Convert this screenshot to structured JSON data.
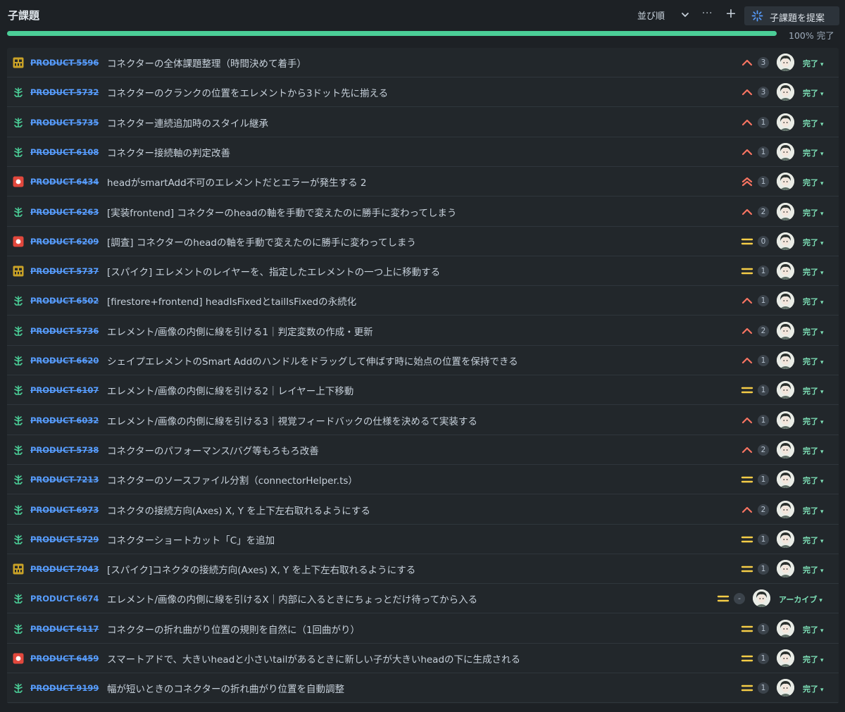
{
  "header": {
    "title": "子課題",
    "sort_label": "並び順",
    "more_label": "···",
    "add_label": "+",
    "suggest_label": "子課題を提案",
    "progress_percent": 100,
    "progress_text": "100% 完了"
  },
  "colors": {
    "background": "#1d2125",
    "list_background": "#22272b",
    "progress": "#4bce97",
    "key_link": "#579dff",
    "status_done": "#7ee2b8",
    "priority_high": "#f87462",
    "priority_medium": "#f5cd47",
    "story": "#4bce97",
    "bug": "#e2483d",
    "epic_task": "#c9a227"
  },
  "rows": [
    {
      "type": "task-icon",
      "key": "PRODUCT-5596",
      "done": true,
      "summary": "コネクターの全体課題整理（時間決めて着手）",
      "priority": "high",
      "count": "3",
      "status": "完了"
    },
    {
      "type": "story-icon",
      "key": "PRODUCT-5732",
      "done": true,
      "summary": "コネクターのクランクの位置をエレメントから3ドット先に揃える",
      "priority": "high",
      "count": "3",
      "status": "完了"
    },
    {
      "type": "story-icon",
      "key": "PRODUCT-5735",
      "done": true,
      "summary": "コネクター連続追加時のスタイル継承",
      "priority": "high",
      "count": "1",
      "status": "完了"
    },
    {
      "type": "story-icon",
      "key": "PRODUCT-6108",
      "done": true,
      "summary": "コネクター接続軸の判定改善",
      "priority": "high",
      "count": "1",
      "status": "完了"
    },
    {
      "type": "bug-icon",
      "key": "PRODUCT-6434",
      "done": true,
      "summary": "headがsmartAdd不可のエレメントだとエラーが発生する 2",
      "priority": "highest",
      "count": "1",
      "status": "完了"
    },
    {
      "type": "story-icon",
      "key": "PRODUCT-6263",
      "done": true,
      "summary": "[実装frontend] コネクターのheadの軸を手動で変えたのに勝手に変わってしまう",
      "priority": "high",
      "count": "2",
      "status": "完了"
    },
    {
      "type": "bug-icon",
      "key": "PRODUCT-6209",
      "done": true,
      "summary": "[調査] コネクターのheadの軸を手動で変えたのに勝手に変わってしまう",
      "priority": "medium",
      "count": "0",
      "status": "完了"
    },
    {
      "type": "task-icon",
      "key": "PRODUCT-5737",
      "done": true,
      "summary": "[スパイク] エレメントのレイヤーを、指定したエレメントの一つ上に移動する",
      "priority": "medium",
      "count": "1",
      "status": "完了"
    },
    {
      "type": "story-icon",
      "key": "PRODUCT-6502",
      "done": true,
      "summary": "[firestore+frontend] headIsFixedとtailIsFixedの永続化",
      "priority": "high",
      "count": "1",
      "status": "完了"
    },
    {
      "type": "story-icon",
      "key": "PRODUCT-5736",
      "done": true,
      "summary": "エレメント/画像の内側に線を引ける1｜判定変数の作成・更新",
      "priority": "high",
      "count": "2",
      "status": "完了"
    },
    {
      "type": "story-icon",
      "key": "PRODUCT-6620",
      "done": true,
      "summary": "シェイプエレメントのSmart Addのハンドルをドラッグして伸ばす時に始点の位置を保持できる",
      "priority": "high",
      "count": "1",
      "status": "完了"
    },
    {
      "type": "story-icon",
      "key": "PRODUCT-6107",
      "done": true,
      "summary": "エレメント/画像の内側に線を引ける2｜レイヤー上下移動",
      "priority": "medium",
      "count": "1",
      "status": "完了"
    },
    {
      "type": "story-icon",
      "key": "PRODUCT-6032",
      "done": true,
      "summary": "エレメント/画像の内側に線を引ける3｜視覚フィードバックの仕様を決めるて実装する",
      "priority": "high",
      "count": "1",
      "status": "完了"
    },
    {
      "type": "story-icon",
      "key": "PRODUCT-5738",
      "done": true,
      "summary": "コネクターのパフォーマンス/バグ等もろもろ改善",
      "priority": "high",
      "count": "2",
      "status": "完了"
    },
    {
      "type": "story-icon",
      "key": "PRODUCT-7213",
      "done": true,
      "summary": "コネクターのソースファイル分割（connectorHelper.ts）",
      "priority": "medium",
      "count": "1",
      "status": "完了"
    },
    {
      "type": "story-icon",
      "key": "PRODUCT-6973",
      "done": true,
      "summary": "コネクタの接続方向(Axes) X, Y を上下左右取れるようにする",
      "priority": "high",
      "count": "2",
      "status": "完了"
    },
    {
      "type": "story-icon",
      "key": "PRODUCT-5729",
      "done": true,
      "summary": "コネクターショートカット「C」を追加",
      "priority": "medium",
      "count": "1",
      "status": "完了"
    },
    {
      "type": "task-icon",
      "key": "PRODUCT-7043",
      "done": true,
      "summary": "[スパイク]コネクタの接続方向(Axes) X, Y を上下左右取れるようにする",
      "priority": "medium",
      "count": "1",
      "status": "完了"
    },
    {
      "type": "story-icon",
      "key": "PRODUCT-6674",
      "done": false,
      "summary": "エレメント/画像の内側に線を引けるX｜内部に入るときにちょっとだけ待ってから入る",
      "priority": "medium",
      "count": "-",
      "status": "アーカイブ",
      "alt": true
    },
    {
      "type": "story-icon",
      "key": "PRODUCT-6117",
      "done": true,
      "summary": "コネクターの折れ曲がり位置の規則を自然に（1回曲がり）",
      "priority": "medium",
      "count": "1",
      "status": "完了"
    },
    {
      "type": "bug-icon",
      "key": "PRODUCT-6459",
      "done": true,
      "summary": "スマートアドで、大きいheadと小さいtailがあるときに新しい子が大きいheadの下に生成される",
      "priority": "medium",
      "count": "1",
      "status": "完了"
    },
    {
      "type": "story-icon",
      "key": "PRODUCT-9199",
      "done": true,
      "summary": "幅が短いときのコネクターの折れ曲がり位置を自動調整",
      "priority": "medium",
      "count": "1",
      "status": "完了"
    }
  ]
}
